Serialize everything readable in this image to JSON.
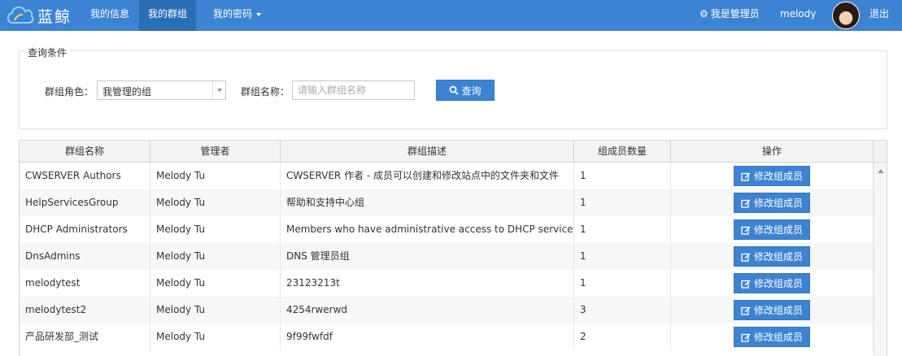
{
  "header": {
    "logo_text": "蓝鲸",
    "nav": [
      {
        "label": "我的信息"
      },
      {
        "label": "我的群组"
      },
      {
        "label": "我的密码"
      }
    ],
    "admin_label": "我是管理员",
    "username": "melody",
    "logout_label": "退出",
    "accent_color": "#3d83d3"
  },
  "query": {
    "legend": "查询条件",
    "role_label": "群组角色：",
    "role_value": "我管理的组",
    "name_label": "群组名称：",
    "name_placeholder": "请输入群组名称",
    "search_label": "查询"
  },
  "table": {
    "columns": [
      "群组名称",
      "管理者",
      "群组描述",
      "组成员数量",
      "操作"
    ],
    "action_label": "修改组成员",
    "rows": [
      {
        "name": "CWSERVER Authors",
        "manager": "Melody Tu",
        "desc": "CWSERVER 作者 - 成员可以创建和修改站点中的文件夹和文件",
        "count": "1"
      },
      {
        "name": "HelpServicesGroup",
        "manager": "Melody Tu",
        "desc": "帮助和支持中心组",
        "count": "1"
      },
      {
        "name": "DHCP Administrators",
        "manager": "Melody Tu",
        "desc": "Members who have administrative access to DHCP service",
        "count": "1"
      },
      {
        "name": "DnsAdmins",
        "manager": "Melody Tu",
        "desc": "DNS 管理员组",
        "count": "1"
      },
      {
        "name": "melodytest",
        "manager": "Melody Tu",
        "desc": "23123213t",
        "count": "1"
      },
      {
        "name": "melodytest2",
        "manager": "Melody Tu",
        "desc": "4254rwerwd",
        "count": "3"
      },
      {
        "name": "产品研发部_测试",
        "manager": "Melody Tu",
        "desc": "9f99fwfdf",
        "count": "2"
      }
    ]
  }
}
